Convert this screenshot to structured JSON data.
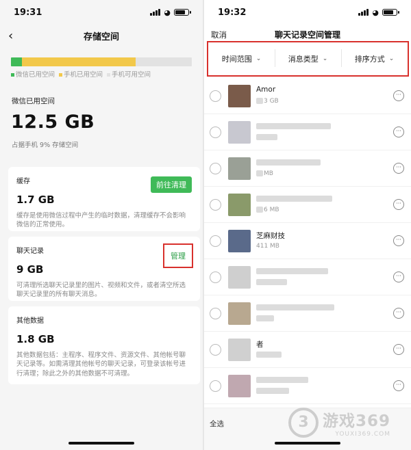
{
  "left": {
    "status_time": "19:31",
    "nav_title": "存储空间",
    "usage": {
      "wechat_fraction": 0.06,
      "phone_fraction": 0.63,
      "colors": {
        "wechat": "#3fba58",
        "phone_used": "#f2c84a",
        "free": "#e2e2e2"
      }
    },
    "legend": [
      "微信已用空间",
      "手机已用空间",
      "手机可用空间"
    ],
    "wechat_used_label": "微信已用空间",
    "wechat_used_size": "12.5 GB",
    "wechat_used_pct": "占据手机 9% 存储空间",
    "cards": [
      {
        "title": "缓存",
        "size": "1.7 GB",
        "desc": "缓存是使用微信过程中产生的临时数据，清理缓存不会影响微信的正常使用。",
        "button": "前往清理"
      },
      {
        "title": "聊天记录",
        "size": "9 GB",
        "desc": "可清理所选聊天记录里的图片、视频和文件，或者清空所选聊天记录里的所有聊天消息。",
        "button": "管理"
      },
      {
        "title": "其他数据",
        "size": "1.8 GB",
        "desc": "其他数据包括：主程序、程序文件、资源文件、其他帐号聊天记录等。如需清理其他帐号的聊天记录，可登录该帐号进行清理；除此之外的其他数据不可清理。"
      }
    ]
  },
  "right": {
    "status_time": "19:32",
    "cancel": "取消",
    "nav_title": "聊天记录空间管理",
    "filters": [
      "时间范围",
      "消息类型",
      "排序方式"
    ],
    "chats": [
      {
        "name": "Amor",
        "size": "3 GB",
        "avatar_color": "#7a5b4a"
      },
      {
        "name": "",
        "size": "",
        "avatar_color": "#c8c8d0"
      },
      {
        "name": "",
        "size": "MB",
        "avatar_color": "#9aa096"
      },
      {
        "name": "",
        "size": "6 MB",
        "avatar_color": "#8a9a6a"
      },
      {
        "name": "芝麻财技",
        "size": "411 MB",
        "avatar_color": "#5a6a8a"
      },
      {
        "name": "",
        "size": "",
        "avatar_color": "#cfcfcf"
      },
      {
        "name": "",
        "size": "",
        "avatar_color": "#b8a890"
      },
      {
        "name": "者",
        "size": "",
        "avatar_color": "#d0d0d0"
      },
      {
        "name": "",
        "size": "",
        "avatar_color": "#c0a8b0"
      }
    ],
    "select_all": "全选"
  },
  "watermark": {
    "logo": "3",
    "text": "游戏369",
    "sub": "YOUXI369.COM"
  }
}
